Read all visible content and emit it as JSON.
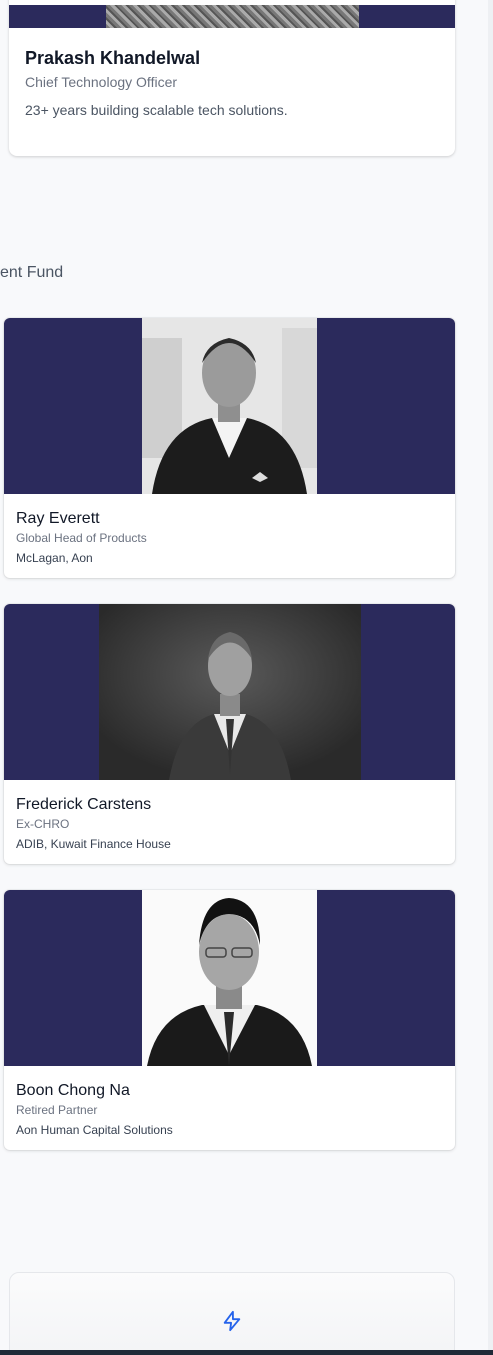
{
  "top_card": {
    "name": "Prakash Khandelwal",
    "role": "Chief Technology Officer",
    "bio": "23+ years building scalable tech solutions."
  },
  "section": {
    "heading": "ent Fund"
  },
  "advisors": [
    {
      "name": "Ray Everett",
      "title": "Global Head of Products",
      "org": "McLagan, Aon",
      "photo": "portrait-light-background"
    },
    {
      "name": "Frederick Carstens",
      "title": "Ex-CHRO",
      "org": "ADIB, Kuwait Finance House",
      "photo": "portrait-dark-background"
    },
    {
      "name": "Boon Chong Na",
      "title": "Retired Partner",
      "org": "Aon Human Capital Solutions",
      "photo": "portrait-white-background"
    }
  ],
  "bottom_card": {
    "icon": "lightning-bolt-icon"
  },
  "colors": {
    "banner": "#2b2a5c",
    "accent_icon": "#2563eb"
  }
}
